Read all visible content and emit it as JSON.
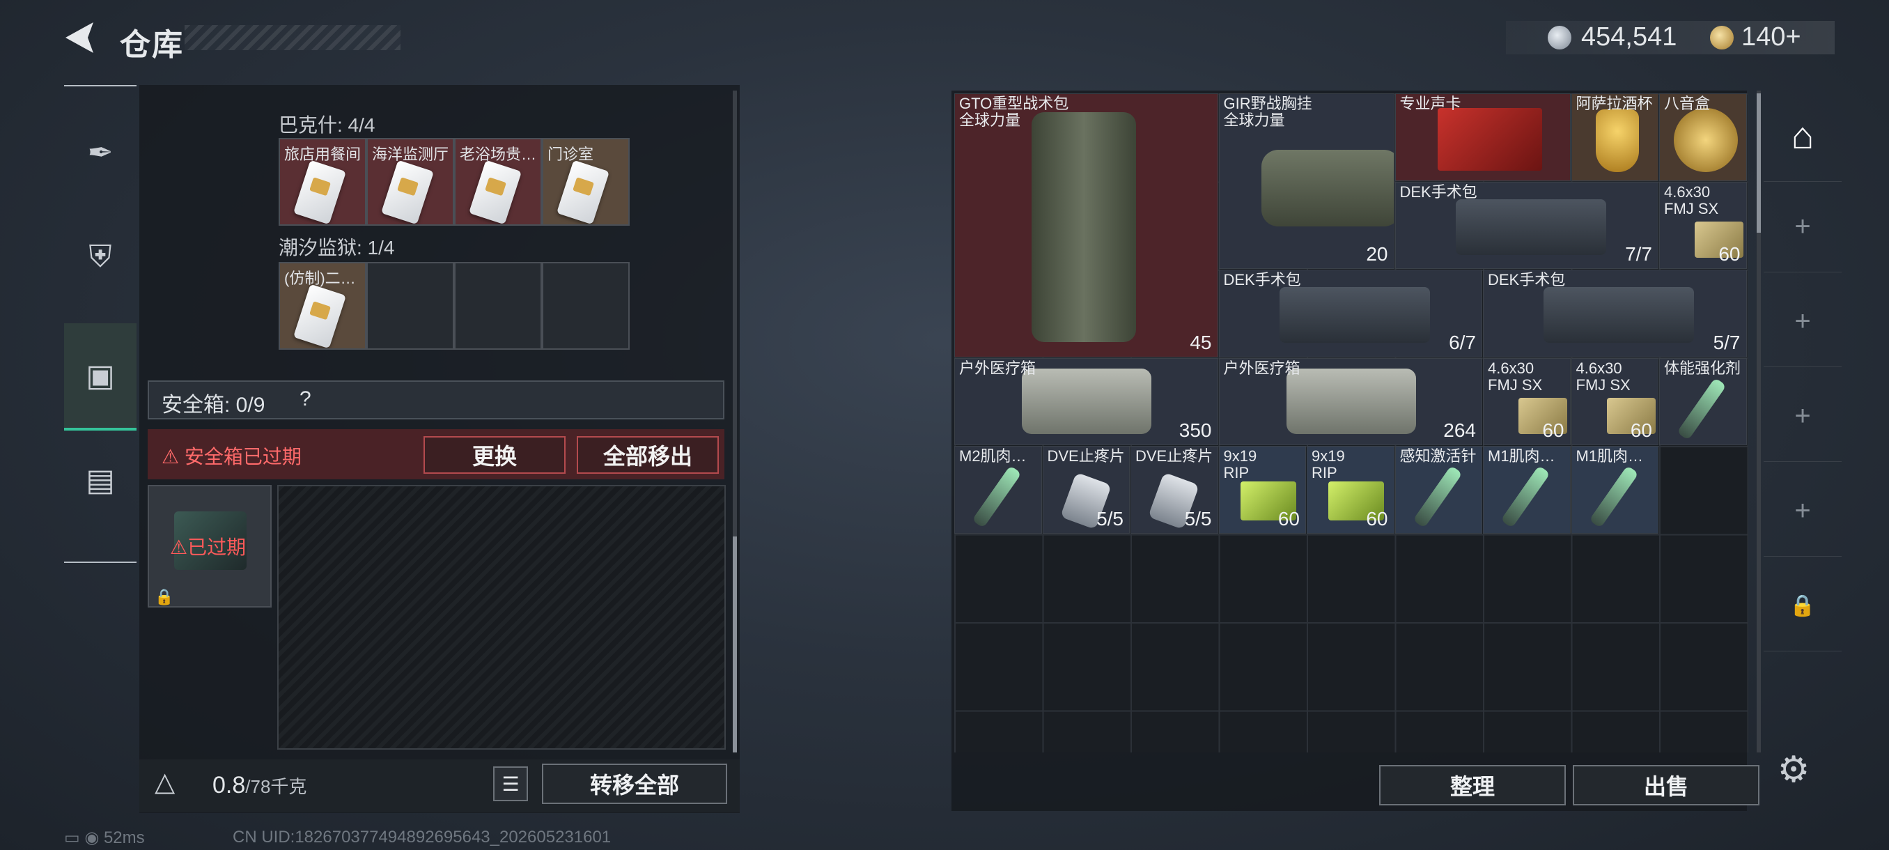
{
  "header": {
    "title": "仓库",
    "money": "454,541",
    "coins": "140+"
  },
  "left_nav": {
    "items": [
      "weapon-icon",
      "armor-icon",
      "backpack-icon",
      "toolbox-icon"
    ],
    "active": 2
  },
  "key_groups": [
    {
      "label": "巴克什: 4/4",
      "slots": [
        {
          "name": "旅店用餐间",
          "bg": "red"
        },
        {
          "name": "海洋监测厅",
          "bg": "red"
        },
        {
          "name": "老浴场贵…",
          "bg": "red"
        },
        {
          "name": "门诊室",
          "bg": "tan"
        }
      ]
    },
    {
      "label": "潮汐监狱: 1/4",
      "slots": [
        {
          "name": "(仿制)二…",
          "bg": "tan"
        }
      ]
    }
  ],
  "safe_box": {
    "label": "安全箱:  0/9",
    "help": "?",
    "expired_msg": "安全箱已过期",
    "replace_label": "更换",
    "remove_all_label": "全部移出",
    "case_status": "已过期"
  },
  "weight": {
    "value": "0.8",
    "max": "/78千克"
  },
  "transfer_label": "转移全部",
  "inventory": {
    "items": [
      {
        "name": "GTO重型战术包\n全球力量",
        "count": "45",
        "color": "red",
        "kind": "backpack"
      },
      {
        "name": "GIR野战胸挂\n全球力量",
        "count": "20",
        "color": "gray",
        "kind": "vest"
      },
      {
        "name": "专业声卡",
        "count": "",
        "color": "red",
        "kind": "card"
      },
      {
        "name": "阿萨拉酒杯",
        "count": "",
        "color": "brown",
        "kind": "cup"
      },
      {
        "name": "八音盒",
        "count": "",
        "color": "brown",
        "kind": "musicbox"
      },
      {
        "name": "DEK手术包",
        "count": "7/7",
        "color": "gray",
        "kind": "surgery"
      },
      {
        "name": "4.6x30\nFMJ SX",
        "count": "60",
        "color": "gray",
        "kind": "ammo"
      },
      {
        "name": "DEK手术包",
        "count": "6/7",
        "color": "gray",
        "kind": "surgery"
      },
      {
        "name": "DEK手术包",
        "count": "5/7",
        "color": "gray",
        "kind": "surgery"
      },
      {
        "name": "户外医疗箱",
        "count": "350",
        "color": "gray",
        "kind": "medkit"
      },
      {
        "name": "户外医疗箱",
        "count": "264",
        "color": "gray",
        "kind": "medkit"
      },
      {
        "name": "4.6x30\nFMJ SX",
        "count": "60",
        "color": "gray",
        "kind": "ammo"
      },
      {
        "name": "4.6x30\nFMJ SX",
        "count": "60",
        "color": "gray",
        "kind": "ammo"
      },
      {
        "name": "体能强化剂",
        "count": "",
        "color": "gray",
        "kind": "injector"
      },
      {
        "name": "M2肌肉…",
        "count": "",
        "color": "gray",
        "kind": "injector"
      },
      {
        "name": "DVE止疼片",
        "count": "5/5",
        "color": "gray",
        "kind": "pills"
      },
      {
        "name": "DVE止疼片",
        "count": "5/5",
        "color": "gray",
        "kind": "pills"
      },
      {
        "name": "9x19\nRIP",
        "count": "60",
        "color": "blue",
        "kind": "ammo-green"
      },
      {
        "name": "9x19\nRIP",
        "count": "60",
        "color": "blue",
        "kind": "ammo-green"
      },
      {
        "name": "感知激活针",
        "count": "",
        "color": "blue",
        "kind": "injector"
      },
      {
        "name": "M1肌肉…",
        "count": "",
        "color": "blue",
        "kind": "injector"
      },
      {
        "name": "M1肌肉…",
        "count": "",
        "color": "blue",
        "kind": "injector"
      }
    ]
  },
  "right_nav": {
    "items": [
      "warehouse-icon",
      "plus-icon",
      "plus-icon",
      "plus-icon",
      "plus-icon",
      "lock-icon"
    ]
  },
  "sort_label": "整理",
  "sell_label": "出售",
  "status": {
    "ping": "52ms",
    "uid": "CN UID:182670377494892695643_202605231601"
  }
}
